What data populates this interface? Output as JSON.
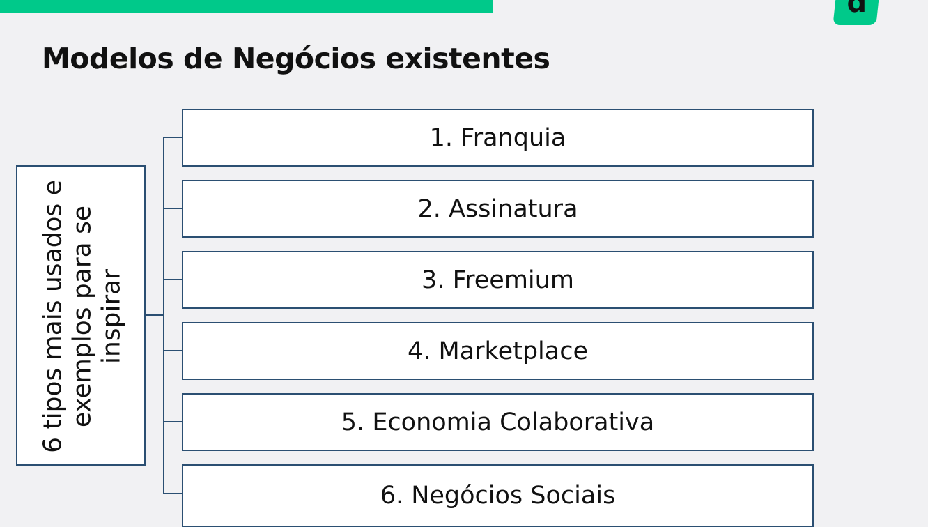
{
  "title": "Modelos de Negócios existentes",
  "logo": {
    "letter": "d",
    "color": "#00c98a"
  },
  "accent_color": "#00c98a",
  "border_color": "#2b4f72",
  "root": {
    "label": "6 tipos mais usados e exemplos para se inspirar"
  },
  "items": [
    {
      "label": "1. Franquia"
    },
    {
      "label": "2. Assinatura"
    },
    {
      "label": "3. Freemium"
    },
    {
      "label": "4. Marketplace"
    },
    {
      "label": "5. Economia Colaborativa"
    },
    {
      "label": "6. Negócios Sociais"
    }
  ]
}
